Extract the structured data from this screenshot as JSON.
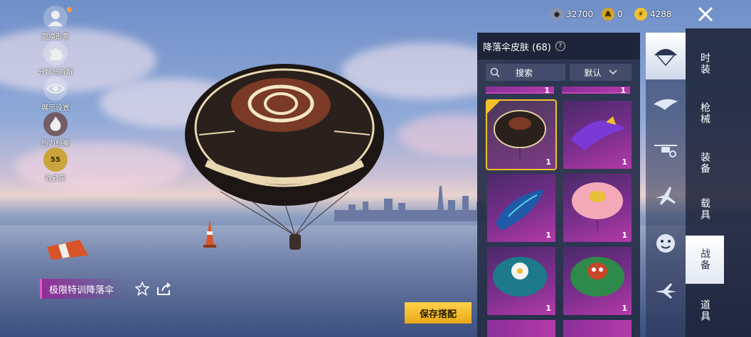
{
  "left_menu": [
    {
      "icon": "avatar-icon",
      "label": "更换形象"
    },
    {
      "icon": "puzzle-icon",
      "label": "分解与拆解"
    },
    {
      "icon": "eye-icon",
      "label": "展示设置"
    },
    {
      "icon": "flame-icon",
      "label": "热力档案"
    },
    {
      "icon": "collector-badge-icon",
      "label": "收藏家",
      "badge": "55"
    }
  ],
  "currencies": [
    {
      "icon": "silver-coin-icon",
      "value": "32700"
    },
    {
      "icon": "gold-coin-icon",
      "value": "0"
    },
    {
      "icon": "uc-coin-icon",
      "value": "4288"
    }
  ],
  "panel": {
    "title": "降落伞皮肤 (68)",
    "help": "?",
    "search_label": "搜索",
    "sort_label": "默认"
  },
  "items": [
    {
      "count": "1",
      "selected": true,
      "style": "celtic-black"
    },
    {
      "count": "1",
      "selected": false,
      "style": "purple-wing"
    },
    {
      "count": "1",
      "selected": false,
      "style": "blue-wing"
    },
    {
      "count": "1",
      "selected": false,
      "style": "pink-parachute"
    },
    {
      "count": "1",
      "selected": false,
      "style": "daisy-parachute"
    },
    {
      "count": "1",
      "selected": false,
      "style": "monkey-parachute"
    }
  ],
  "partial_counts": [
    "1",
    "1"
  ],
  "category_icons": [
    "parachute-icon",
    "glider-icon",
    "drone-icon",
    "plane-icon",
    "emote-icon",
    "jet-icon"
  ],
  "tabs": [
    {
      "label": "时装",
      "active": false
    },
    {
      "label": "枪械",
      "active": false
    },
    {
      "label": "装备",
      "active": false
    },
    {
      "label": "载具",
      "active": false
    },
    {
      "label": "战备",
      "active": true
    },
    {
      "label": "道具",
      "active": false
    }
  ],
  "item_name": "极限特训降落伞",
  "save_label": "保存搭配",
  "colors": {
    "accent_gold": "#f2c12a",
    "item_purple": "#b43aa8",
    "name_magenta": "#e05ad8"
  }
}
